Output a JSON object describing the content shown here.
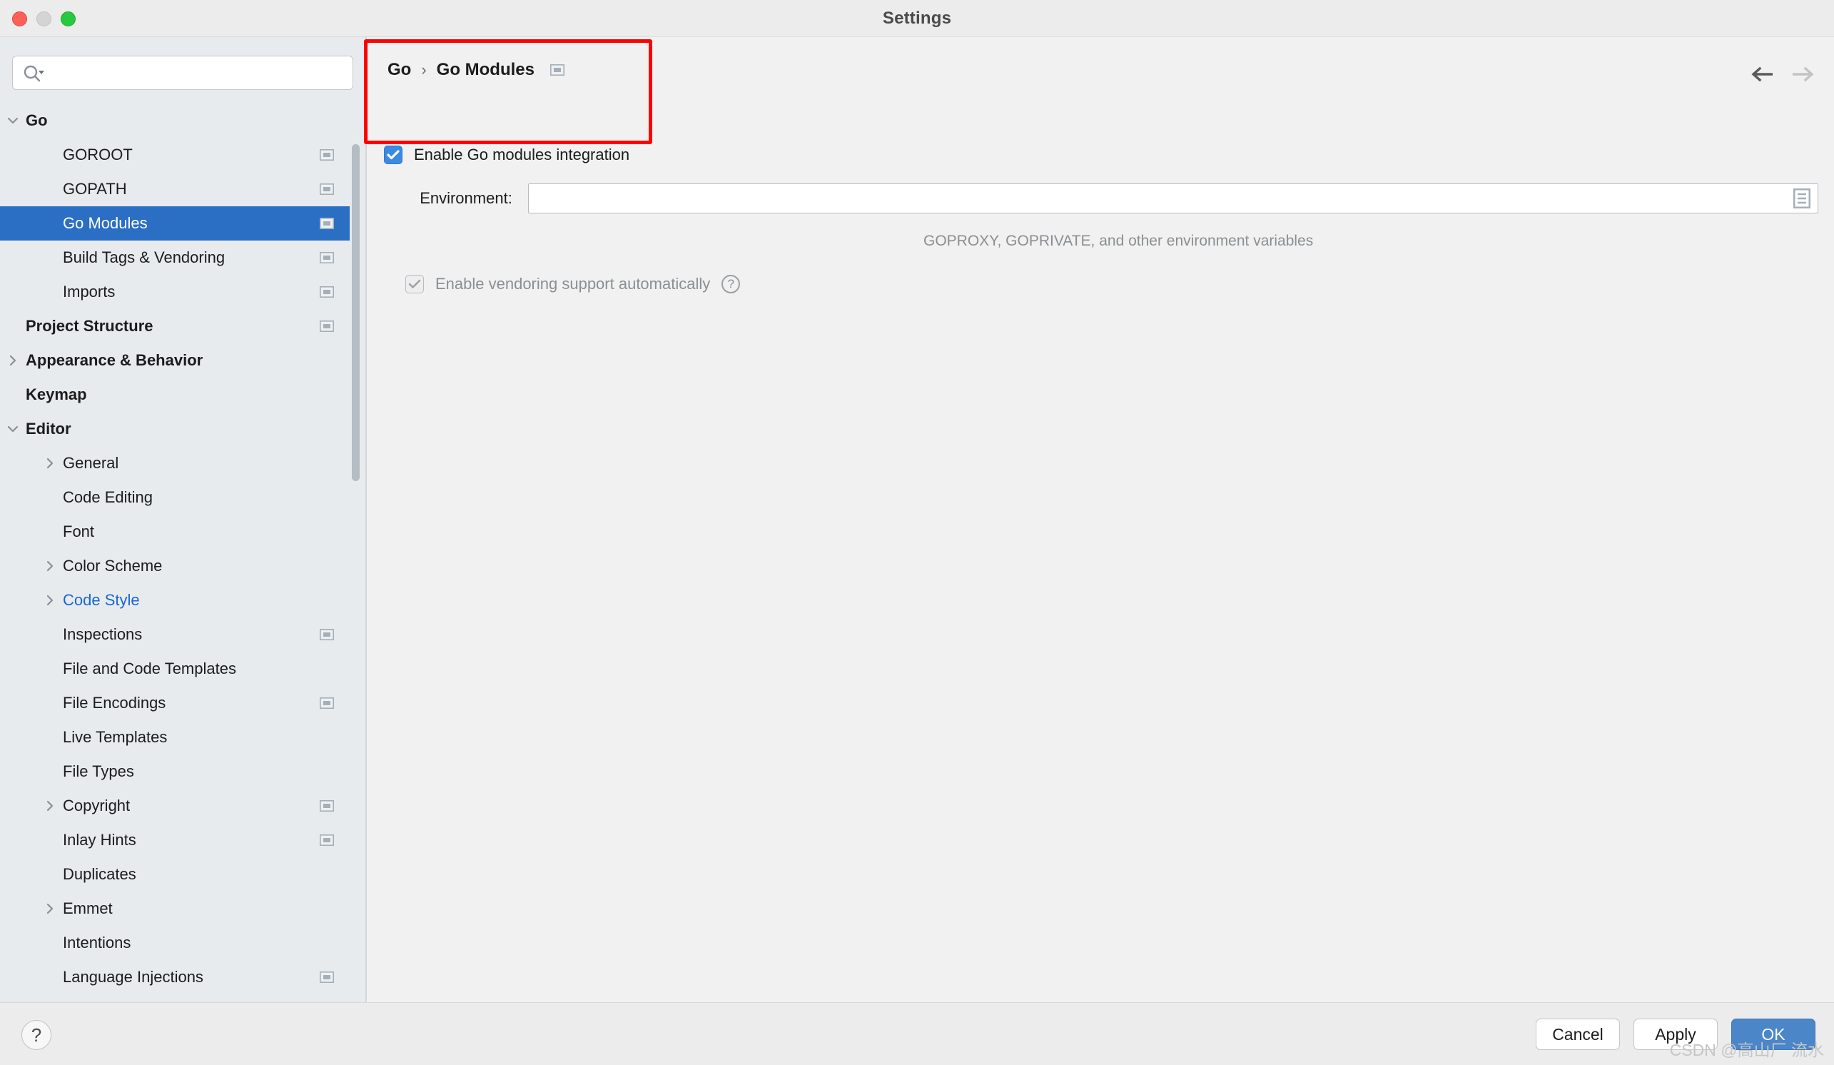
{
  "window": {
    "title": "Settings",
    "traffic_lights": [
      "close",
      "minimize",
      "maximize"
    ]
  },
  "sidebar": {
    "search": {
      "value": "",
      "placeholder": ""
    },
    "items": [
      {
        "label": "Go",
        "depth": 0,
        "bold": true,
        "twisty": "down",
        "badge": false,
        "selected": false,
        "modified": false
      },
      {
        "label": "GOROOT",
        "depth": 1,
        "bold": false,
        "twisty": "none",
        "badge": true,
        "selected": false,
        "modified": false
      },
      {
        "label": "GOPATH",
        "depth": 1,
        "bold": false,
        "twisty": "none",
        "badge": true,
        "selected": false,
        "modified": false
      },
      {
        "label": "Go Modules",
        "depth": 1,
        "bold": false,
        "twisty": "none",
        "badge": true,
        "selected": true,
        "modified": false
      },
      {
        "label": "Build Tags & Vendoring",
        "depth": 1,
        "bold": false,
        "twisty": "none",
        "badge": true,
        "selected": false,
        "modified": false
      },
      {
        "label": "Imports",
        "depth": 1,
        "bold": false,
        "twisty": "none",
        "badge": true,
        "selected": false,
        "modified": false
      },
      {
        "label": "Project Structure",
        "depth": 0,
        "bold": true,
        "twisty": "none",
        "badge": true,
        "selected": false,
        "modified": false
      },
      {
        "label": "Appearance & Behavior",
        "depth": 0,
        "bold": true,
        "twisty": "right",
        "badge": false,
        "selected": false,
        "modified": false
      },
      {
        "label": "Keymap",
        "depth": 0,
        "bold": true,
        "twisty": "none",
        "badge": false,
        "selected": false,
        "modified": false
      },
      {
        "label": "Editor",
        "depth": 0,
        "bold": true,
        "twisty": "down",
        "badge": false,
        "selected": false,
        "modified": false
      },
      {
        "label": "General",
        "depth": 1,
        "bold": false,
        "twisty": "right",
        "badge": false,
        "selected": false,
        "modified": false
      },
      {
        "label": "Code Editing",
        "depth": 1,
        "bold": false,
        "twisty": "none",
        "badge": false,
        "selected": false,
        "modified": false
      },
      {
        "label": "Font",
        "depth": 1,
        "bold": false,
        "twisty": "none",
        "badge": false,
        "selected": false,
        "modified": false
      },
      {
        "label": "Color Scheme",
        "depth": 1,
        "bold": false,
        "twisty": "right",
        "badge": false,
        "selected": false,
        "modified": false
      },
      {
        "label": "Code Style",
        "depth": 1,
        "bold": false,
        "twisty": "right",
        "badge": false,
        "selected": false,
        "modified": true
      },
      {
        "label": "Inspections",
        "depth": 1,
        "bold": false,
        "twisty": "none",
        "badge": true,
        "selected": false,
        "modified": false
      },
      {
        "label": "File and Code Templates",
        "depth": 1,
        "bold": false,
        "twisty": "none",
        "badge": false,
        "selected": false,
        "modified": false
      },
      {
        "label": "File Encodings",
        "depth": 1,
        "bold": false,
        "twisty": "none",
        "badge": true,
        "selected": false,
        "modified": false
      },
      {
        "label": "Live Templates",
        "depth": 1,
        "bold": false,
        "twisty": "none",
        "badge": false,
        "selected": false,
        "modified": false
      },
      {
        "label": "File Types",
        "depth": 1,
        "bold": false,
        "twisty": "none",
        "badge": false,
        "selected": false,
        "modified": false
      },
      {
        "label": "Copyright",
        "depth": 1,
        "bold": false,
        "twisty": "right",
        "badge": true,
        "selected": false,
        "modified": false
      },
      {
        "label": "Inlay Hints",
        "depth": 1,
        "bold": false,
        "twisty": "none",
        "badge": true,
        "selected": false,
        "modified": false
      },
      {
        "label": "Duplicates",
        "depth": 1,
        "bold": false,
        "twisty": "none",
        "badge": false,
        "selected": false,
        "modified": false
      },
      {
        "label": "Emmet",
        "depth": 1,
        "bold": false,
        "twisty": "right",
        "badge": false,
        "selected": false,
        "modified": false
      },
      {
        "label": "Intentions",
        "depth": 1,
        "bold": false,
        "twisty": "none",
        "badge": false,
        "selected": false,
        "modified": false
      },
      {
        "label": "Language Injections",
        "depth": 1,
        "bold": false,
        "twisty": "none",
        "badge": true,
        "selected": false,
        "modified": false
      }
    ]
  },
  "main": {
    "breadcrumb": {
      "root": "Go",
      "separator": "›",
      "leaf": "Go Modules"
    },
    "nav": {
      "back": "back-arrow",
      "forward": "forward-arrow"
    },
    "enable_modules": {
      "label": "Enable Go modules integration",
      "checked": true,
      "enabled": true
    },
    "environment": {
      "label": "Environment:",
      "value": "",
      "placeholder": "",
      "hint": "GOPROXY, GOPRIVATE, and other environment variables",
      "browse_icon": "list-editor-icon"
    },
    "vendoring": {
      "label": "Enable vendoring support automatically",
      "checked": true,
      "enabled": false,
      "help": "?"
    }
  },
  "footer": {
    "help_label": "?",
    "cancel_label": "Cancel",
    "apply_label": "Apply",
    "ok_label": "OK"
  },
  "watermark": {
    "text": "CSDN @高山厂 流水"
  },
  "colors": {
    "selection": "#2b6fc4",
    "accent": "#4a86c8",
    "annotation": "#ff0000",
    "modified_link": "#1a66d6",
    "sidebar_bg": "#e7ebee",
    "panel_bg": "#f1f1f1"
  }
}
